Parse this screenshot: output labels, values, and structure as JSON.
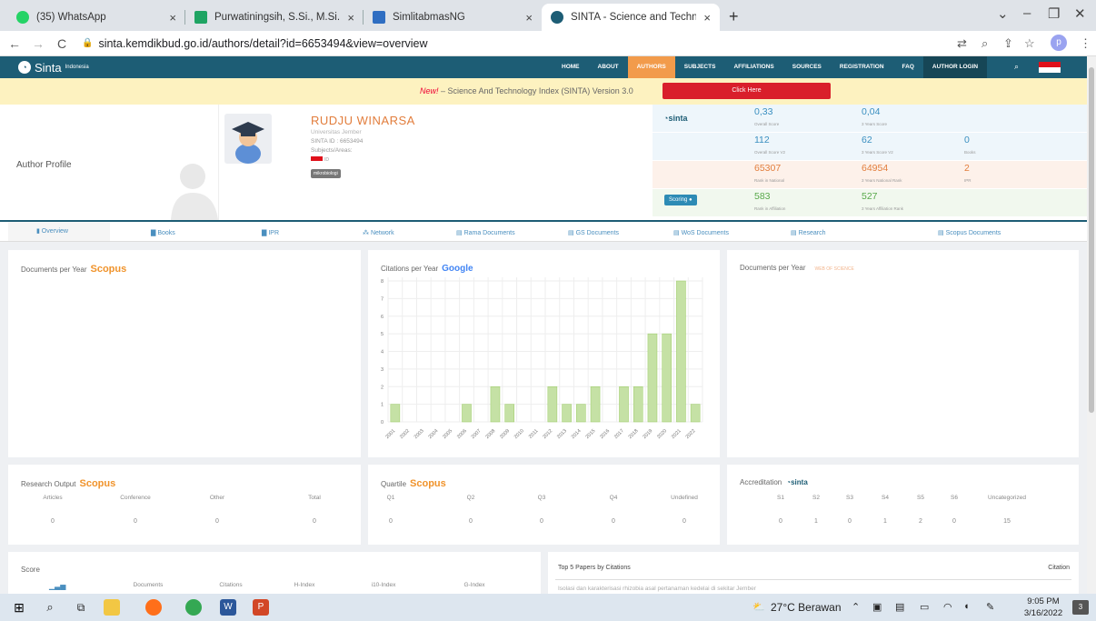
{
  "browser": {
    "tabs": [
      {
        "title": "(35) WhatsApp",
        "color": "#25d366"
      },
      {
        "title": "Purwatiningsih, S.Si., M.Si., Ph.D.",
        "color": "#1fa463"
      },
      {
        "title": "SimlitabmasNG",
        "color": "#2f6ec2"
      },
      {
        "title": "SINTA - Science and Technology",
        "color": "#1d5d75"
      }
    ],
    "close_glyph": "×",
    "new_tab": "+",
    "url": "sinta.kemdikbud.go.id/authors/detail?id=6653494&view=overview",
    "profile_initial": "p"
  },
  "site": {
    "logo": "Sinta",
    "logo_sup": "Indonesia",
    "nav": [
      "HOME",
      "ABOUT",
      "AUTHORS",
      "SUBJECTS",
      "AFFILIATIONS",
      "SOURCES",
      "REGISTRATION",
      "FAQ",
      "AUTHOR LOGIN"
    ],
    "active_nav": "AUTHORS"
  },
  "banner": {
    "new": "New!",
    "text": " – Science And Technology Index (SINTA) Version 3.0",
    "button": "Click Here"
  },
  "profile": {
    "section_label": "Author Profile",
    "name": "RUDJU WINARSA",
    "affiliation": "Universitas Jember",
    "sinta_id": "SINTA ID : 6653494",
    "subjects": "Subjects/Areas:",
    "country": "ID",
    "tag": "mikrobiologi"
  },
  "scores": {
    "brand": "sinta",
    "scoring_button": "Scoring",
    "rows": [
      [
        {
          "v": "0,33",
          "s": "Overall Score"
        },
        {
          "v": "0,04",
          "s": "3 Years Score"
        }
      ],
      [
        {
          "v": "112",
          "s": "Overall Score V2"
        },
        {
          "v": "62",
          "s": "3 Years Score V2"
        },
        {
          "v": "0",
          "s": "Books"
        }
      ],
      [
        {
          "v": "65307",
          "s": "Rank in National"
        },
        {
          "v": "64954",
          "s": "3 Years National Rank"
        },
        {
          "v": "2",
          "s": "IPR"
        }
      ],
      [
        {
          "v": "583",
          "s": "Rank in Affiliation"
        },
        {
          "v": "527",
          "s": "3 Years Affiliation Rank"
        }
      ]
    ],
    "row_colors": [
      "#3a8fc0",
      "#3a8fc0",
      "#e27d3c",
      "#58a94a"
    ]
  },
  "tabs": [
    "Overview",
    "Books",
    "IPR",
    "Network",
    "Rama Documents",
    "GS Documents",
    "WoS Documents",
    "Research",
    "Scopus Documents"
  ],
  "cards": {
    "docs_scopus_title": "Documents per Year",
    "scopus_brand": "Scopus",
    "citations_title": "Citations per Year",
    "google_brand": "Google",
    "docs_wos_title": "Documents per Year",
    "wos_brand": "WEB OF SCIENCE",
    "research_title": "Research Output",
    "research_cols": [
      "Articles",
      "Conference",
      "Other",
      "Total"
    ],
    "research_vals": [
      "0",
      "0",
      "0",
      "0"
    ],
    "quartile_title": "Quartile",
    "quartile_cols": [
      "Q1",
      "Q2",
      "Q3",
      "Q4",
      "Undefined"
    ],
    "quartile_vals": [
      "0",
      "0",
      "0",
      "0",
      "0"
    ],
    "accr_title": "Accreditation",
    "accr_cols": [
      "S1",
      "S2",
      "S3",
      "S4",
      "S5",
      "S6",
      "Uncategorized"
    ],
    "accr_vals": [
      "0",
      "1",
      "0",
      "1",
      "2",
      "0",
      "15"
    ],
    "score_title": "Score",
    "score_cols": [
      "Documents",
      "Citations",
      "H-Index",
      "i10-Index",
      "G-Index"
    ],
    "top5_title": "Top 5 Papers by Citations",
    "top5_col": "Citation",
    "top5_first": "Isolasi dan karakterisasi rhizobia asal pertanaman kedelai di sekitar Jember"
  },
  "chart_data": {
    "type": "bar",
    "categories": [
      "2001",
      "2002",
      "2003",
      "2004",
      "2005",
      "2006",
      "2007",
      "2008",
      "2009",
      "2010",
      "2011",
      "2012",
      "2013",
      "2014",
      "2015",
      "2016",
      "2017",
      "2018",
      "2019",
      "2020",
      "2021",
      "2022"
    ],
    "values": [
      1,
      0,
      0,
      0,
      0,
      1,
      0,
      2,
      1,
      0,
      0,
      2,
      1,
      1,
      2,
      0,
      2,
      2,
      5,
      5,
      8,
      1
    ],
    "ylim": [
      0,
      8
    ],
    "yticks": [
      "0",
      "1",
      "2",
      "3",
      "4",
      "5",
      "6",
      "7",
      "8"
    ],
    "color": "#c5e1a5",
    "stroke": "#9ccc65"
  },
  "taskbar": {
    "weather": "27°C Berawan",
    "time": "9:05 PM",
    "date": "3/16/2022",
    "notif": "3"
  }
}
